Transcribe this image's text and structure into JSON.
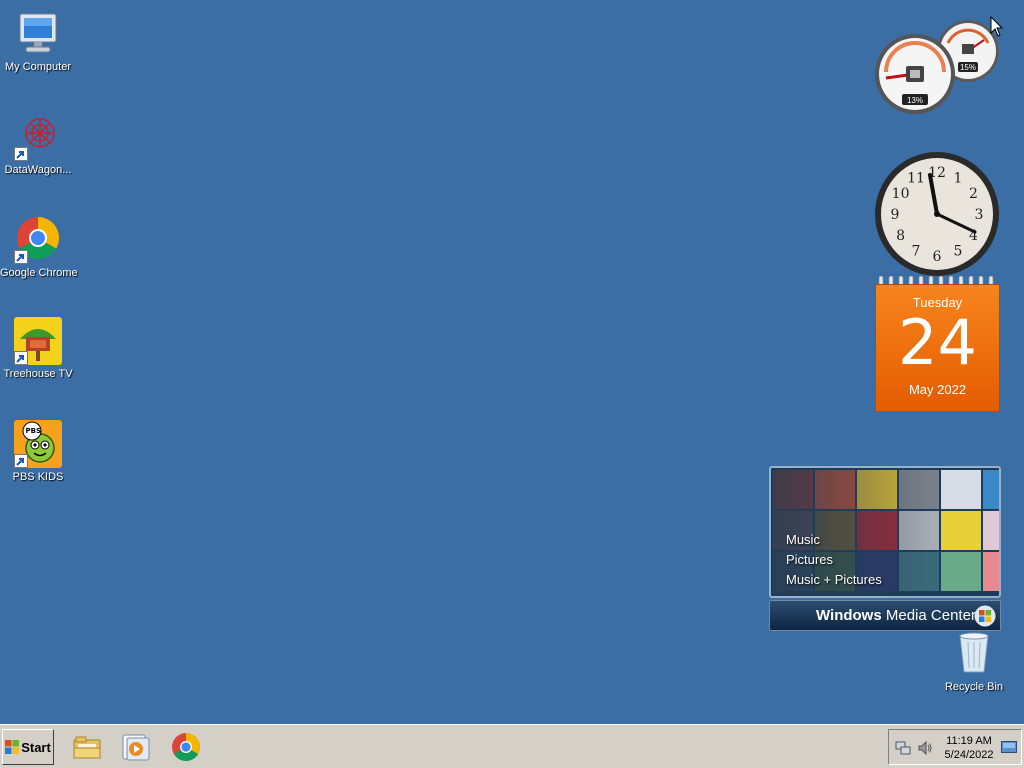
{
  "desktop": {
    "icons": [
      {
        "label": "My Computer"
      },
      {
        "label": "DataWagon..."
      },
      {
        "label": "Google Chrome"
      },
      {
        "label": "Treehouse TV"
      },
      {
        "label": "PBS KIDS"
      }
    ],
    "recycle_bin": {
      "label": "Recycle Bin"
    }
  },
  "gadgets": {
    "cpu_meter": {
      "cpu": "13%",
      "memory": "15%"
    },
    "clock": {
      "numerals": [
        "12",
        "1",
        "2",
        "3",
        "4",
        "5",
        "6",
        "7",
        "8",
        "9",
        "10",
        "11"
      ]
    },
    "calendar": {
      "weekday": "Tuesday",
      "day": "24",
      "month_year": "May 2022"
    },
    "media_center": {
      "menu": [
        "Music",
        "Pictures",
        "Music + Pictures"
      ],
      "brand_bold": "Windows",
      "brand_rest": " Media Center"
    }
  },
  "taskbar": {
    "start_label": "Start",
    "pinned": [
      "file-explorer-icon",
      "media-player-icon",
      "chrome-icon"
    ],
    "tray": {
      "time": "11:19 AM",
      "date": "5/24/2022"
    }
  }
}
